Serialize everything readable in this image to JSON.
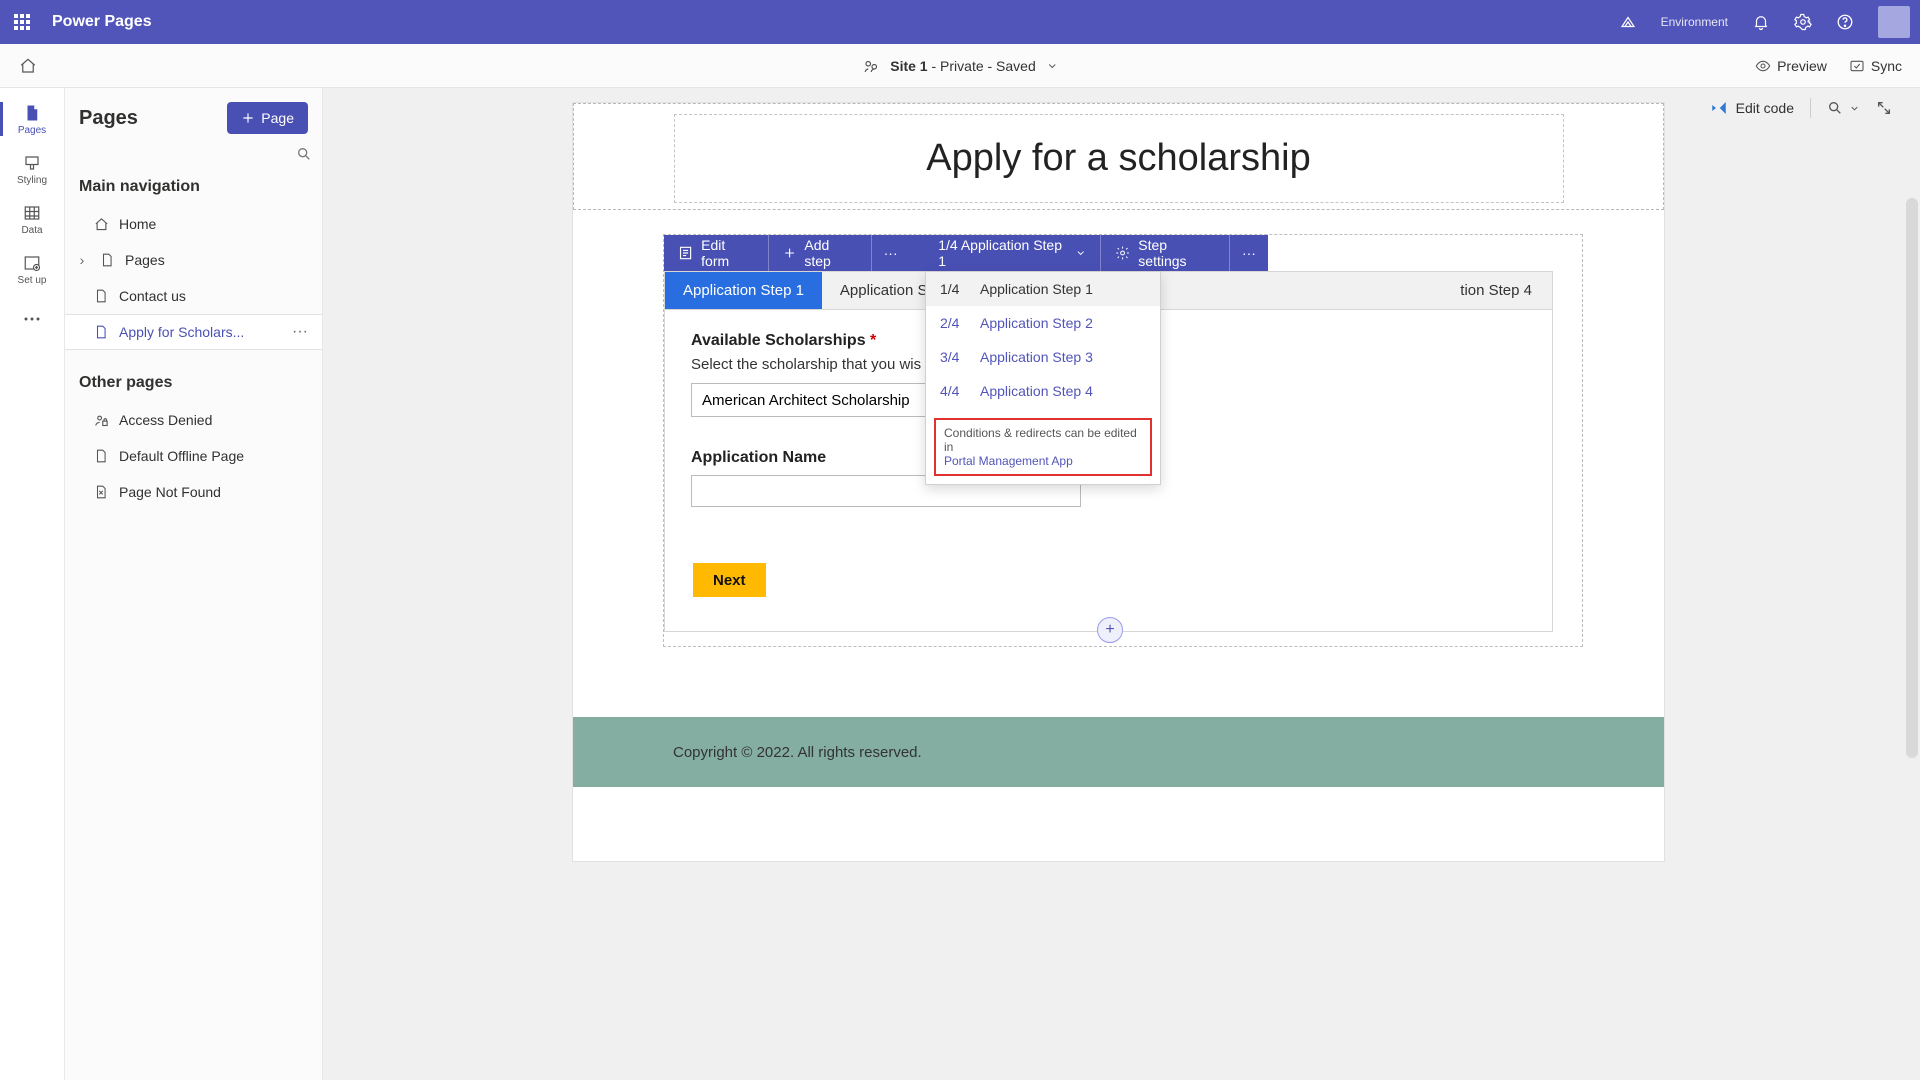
{
  "header": {
    "brand": "Power Pages",
    "env_label": "Environment",
    "env_value": ""
  },
  "secondbar": {
    "site_prefix": "Site 1",
    "site_suffix": " - Private - Saved",
    "preview": "Preview",
    "sync": "Sync"
  },
  "rail": {
    "pages": "Pages",
    "styling": "Styling",
    "data": "Data",
    "setup": "Set up"
  },
  "panel": {
    "title": "Pages",
    "page_btn": "Page",
    "main_nav": "Main navigation",
    "other_pages": "Other pages",
    "items": {
      "home": "Home",
      "pages": "Pages",
      "contact": "Contact us",
      "apply": "Apply for Scholars...",
      "denied": "Access Denied",
      "offline": "Default Offline Page",
      "notfound": "Page Not Found"
    }
  },
  "canvas": {
    "edit_code": "Edit code",
    "page_title": "Apply for a scholarship",
    "toolbar": {
      "edit_form": "Edit form",
      "add_step": "Add step",
      "step_indicator": "1/4 Application Step 1",
      "step_settings": "Step settings"
    },
    "tabs": [
      "Application Step 1",
      "Application Step 2",
      "Application Step 3",
      "Application Step 4"
    ],
    "tab4_visible": "tion Step 4",
    "form": {
      "scholar_label": "Available Scholarships",
      "scholar_help": "Select the scholarship that you wis",
      "scholar_value": "American Architect Scholarship",
      "appname_label": "Application Name",
      "next": "Next"
    },
    "dropdown": {
      "items": [
        {
          "num": "1/4",
          "label": "Application Step 1"
        },
        {
          "num": "2/4",
          "label": "Application Step 2"
        },
        {
          "num": "3/4",
          "label": "Application Step 3"
        },
        {
          "num": "4/4",
          "label": "Application Step 4"
        }
      ],
      "note_text": "Conditions & redirects can be edited in",
      "note_link": "Portal Management App"
    },
    "footer": "Copyright © 2022. All rights reserved."
  }
}
